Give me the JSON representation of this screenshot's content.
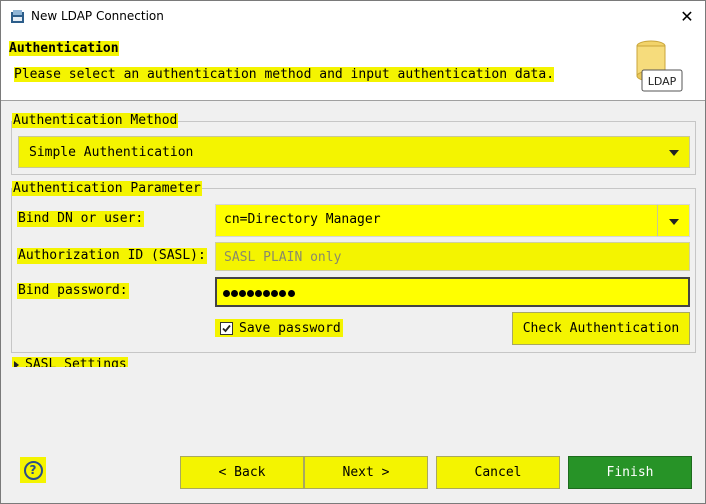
{
  "window": {
    "title": "New LDAP Connection"
  },
  "header": {
    "title": "Authentication",
    "description": "Please select an authentication method and input authentication data.",
    "logo_text": "LDAP"
  },
  "auth_method": {
    "legend": "Authentication Method",
    "selected": "Simple Authentication"
  },
  "auth_param": {
    "legend": "Authentication Parameter",
    "bind_dn_label": "Bind DN or user:",
    "bind_dn_value": "cn=Directory Manager",
    "authz_label": "Authorization ID (SASL):",
    "authz_placeholder": "SASL PLAIN only",
    "password_label": "Bind password:",
    "password_masked_length": 8,
    "save_password_label": "Save password",
    "save_password_checked": true,
    "check_auth_button": "Check Authentication"
  },
  "sasl_section": {
    "label": "SASL Settings",
    "expanded": false
  },
  "footer": {
    "back": "< Back",
    "next": "Next >",
    "cancel": "Cancel",
    "finish": "Finish"
  },
  "colors": {
    "highlight": "#f4f400",
    "finish": "#279327",
    "help": "#2a4e8c"
  }
}
